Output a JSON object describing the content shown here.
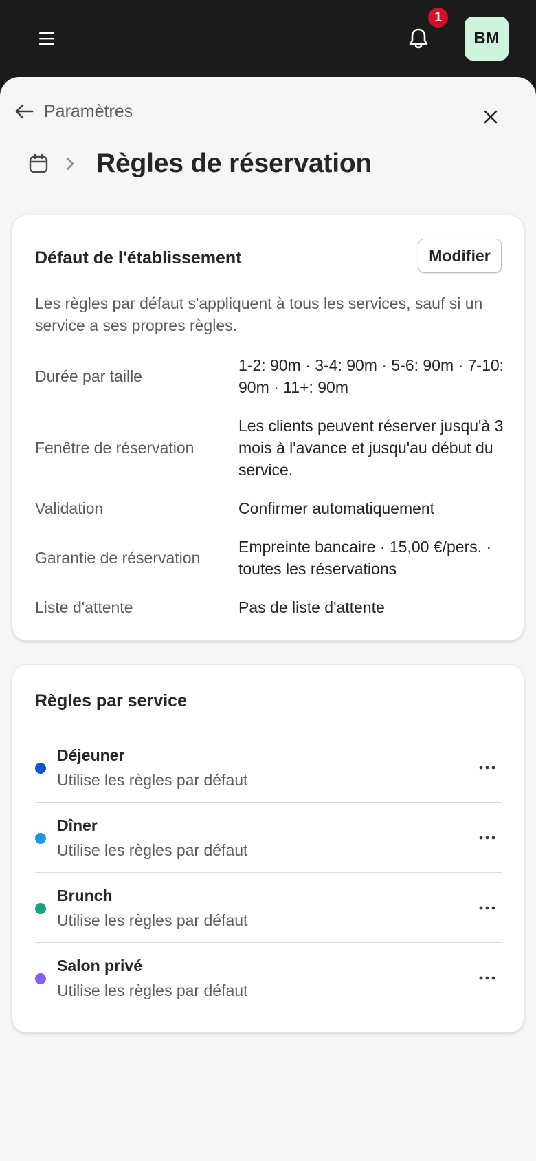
{
  "topbar": {
    "notification_count": "1",
    "avatar_initials": "BM",
    "accent_bg": "#1b1b1b",
    "avatar_bg": "#cdf5dc",
    "badge_color": "#d40f2a"
  },
  "header": {
    "back_label": "Paramètres",
    "title": "Règles de réservation"
  },
  "defaults_card": {
    "title": "Défaut de l'établissement",
    "modify_label": "Modifier",
    "intro": "Les règles par défaut s'appliquent à tous les services, sauf si un service a ses propres règles.",
    "rows": [
      {
        "label": "Durée par taille",
        "value": "1-2: 90m · 3-4: 90m · 5-6: 90m · 7-10: 90m · 11+: 90m"
      },
      {
        "label": "Fenêtre de réservation",
        "value": "Les clients peuvent réserver jusqu'à 3 mois à l'avance et jusqu'au début du service."
      },
      {
        "label": "Validation",
        "value": "Confirmer automatiquement"
      },
      {
        "label": "Garantie de réservation",
        "value": "Empreinte bancaire · 15,00 €/pers. · toutes les réservations"
      },
      {
        "label": "Liste d'attente",
        "value": "Pas de liste d'attente"
      }
    ]
  },
  "services_card": {
    "title": "Règles par service",
    "items": [
      {
        "name": "Déjeuner",
        "status": "Utilise les règles par défaut",
        "color": "#0a56d0"
      },
      {
        "name": "Dîner",
        "status": "Utilise les règles par défaut",
        "color": "#1b98e0"
      },
      {
        "name": "Brunch",
        "status": "Utilise les règles par défaut",
        "color": "#16a37f"
      },
      {
        "name": "Salon privé",
        "status": "Utilise les règles par défaut",
        "color": "#8b5cf6"
      }
    ]
  }
}
